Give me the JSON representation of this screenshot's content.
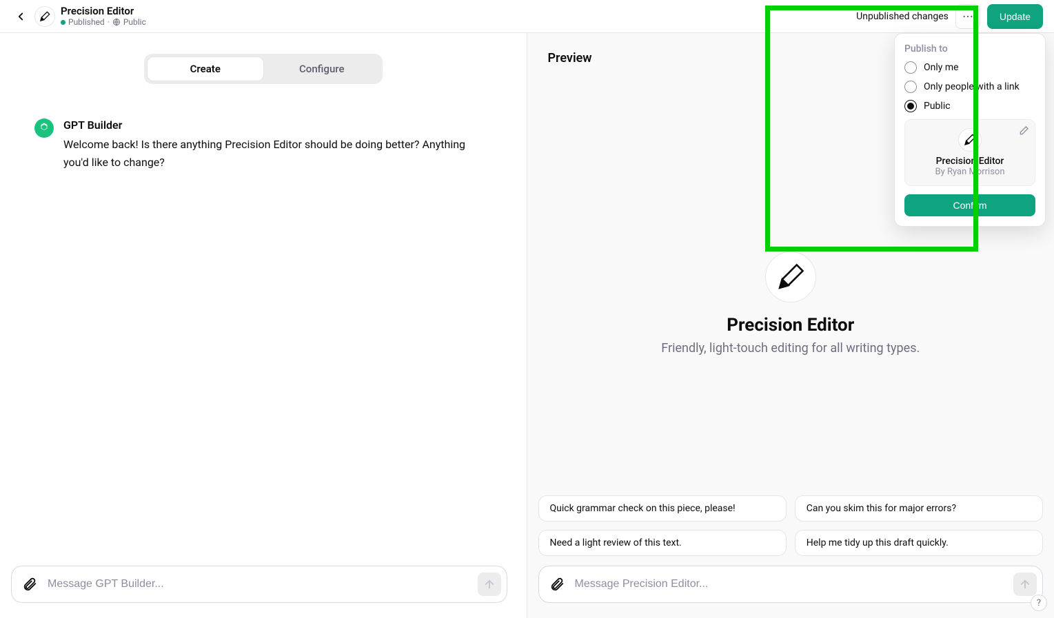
{
  "header": {
    "title": "Precision Editor",
    "status": "Published",
    "visibility_icon_label": "Public",
    "unpublished_text": "Unpublished changes",
    "update_label": "Update"
  },
  "left": {
    "tabs": {
      "create": "Create",
      "configure": "Configure"
    },
    "builder_name": "GPT Builder",
    "builder_message": "Welcome back! Is there anything Precision Editor should be doing better? Anything you'd like to change?",
    "input_placeholder": "Message GPT Builder..."
  },
  "right": {
    "preview_label": "Preview",
    "title": "Precision Editor",
    "description": "Friendly, light-touch editing for all writing types.",
    "prompts": [
      "Quick grammar check on this piece, please!",
      "Can you skim this for major errors?",
      "Need a light review of this text.",
      "Help me tidy up this draft quickly."
    ],
    "input_placeholder": "Message Precision Editor..."
  },
  "publish": {
    "heading": "Publish to",
    "options": [
      "Only me",
      "Only people with a link",
      "Public"
    ],
    "selected_index": 2,
    "card_title": "Precision Editor",
    "card_byline": "By Ryan Morrison",
    "confirm_label": "Confirm"
  },
  "help_label": "?"
}
